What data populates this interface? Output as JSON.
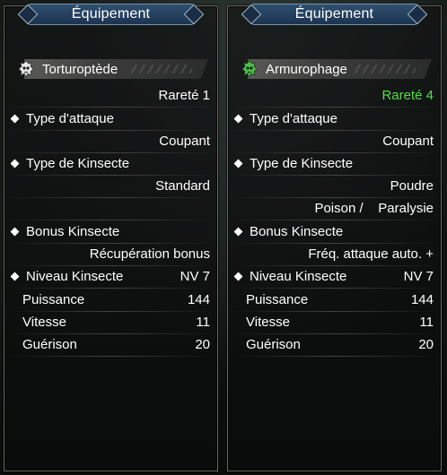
{
  "left_panel": {
    "title": "Équipement",
    "name": "Torturoptède",
    "name_icon": "white-kinsect-icon",
    "rarity": "Rareté 1",
    "attack_type_label": "Type d'attaque",
    "attack_type_value": "Coupant",
    "kinsect_type_label": "Type de Kinsecte",
    "kinsect_type_value": "Standard",
    "kinsect_type_extra": "",
    "bonus_label": "Bonus Kinsecte",
    "bonus_value": "Récupération bonus",
    "level_label": "Niveau Kinsecte",
    "level_value": "NV 7",
    "power_label": "Puissance",
    "power_value": "144",
    "speed_label": "Vitesse",
    "speed_value": "11",
    "heal_label": "Guérison",
    "heal_value": "20"
  },
  "right_panel": {
    "title": "Équipement",
    "name": "Armurophage",
    "name_icon": "green-kinsect-icon",
    "rarity": "Rareté 4",
    "attack_type_label": "Type d'attaque",
    "attack_type_value": "Coupant",
    "kinsect_type_label": "Type de Kinsecte",
    "kinsect_type_value": "Poudre",
    "kinsect_type_extra": "Poison /    Paralysie",
    "bonus_label": "Bonus Kinsecte",
    "bonus_value": "Fréq. attaque auto. +",
    "level_label": "Niveau Kinsecte",
    "level_value": "NV 7",
    "power_label": "Puissance",
    "power_value": "144",
    "speed_label": "Vitesse",
    "speed_value": "11",
    "heal_label": "Guérison",
    "heal_value": "20"
  },
  "colors": {
    "rarity_1": "#ffffff",
    "rarity_4": "#55dd44",
    "title_bar": "#24405e",
    "panel_border": "#6e6a58"
  }
}
